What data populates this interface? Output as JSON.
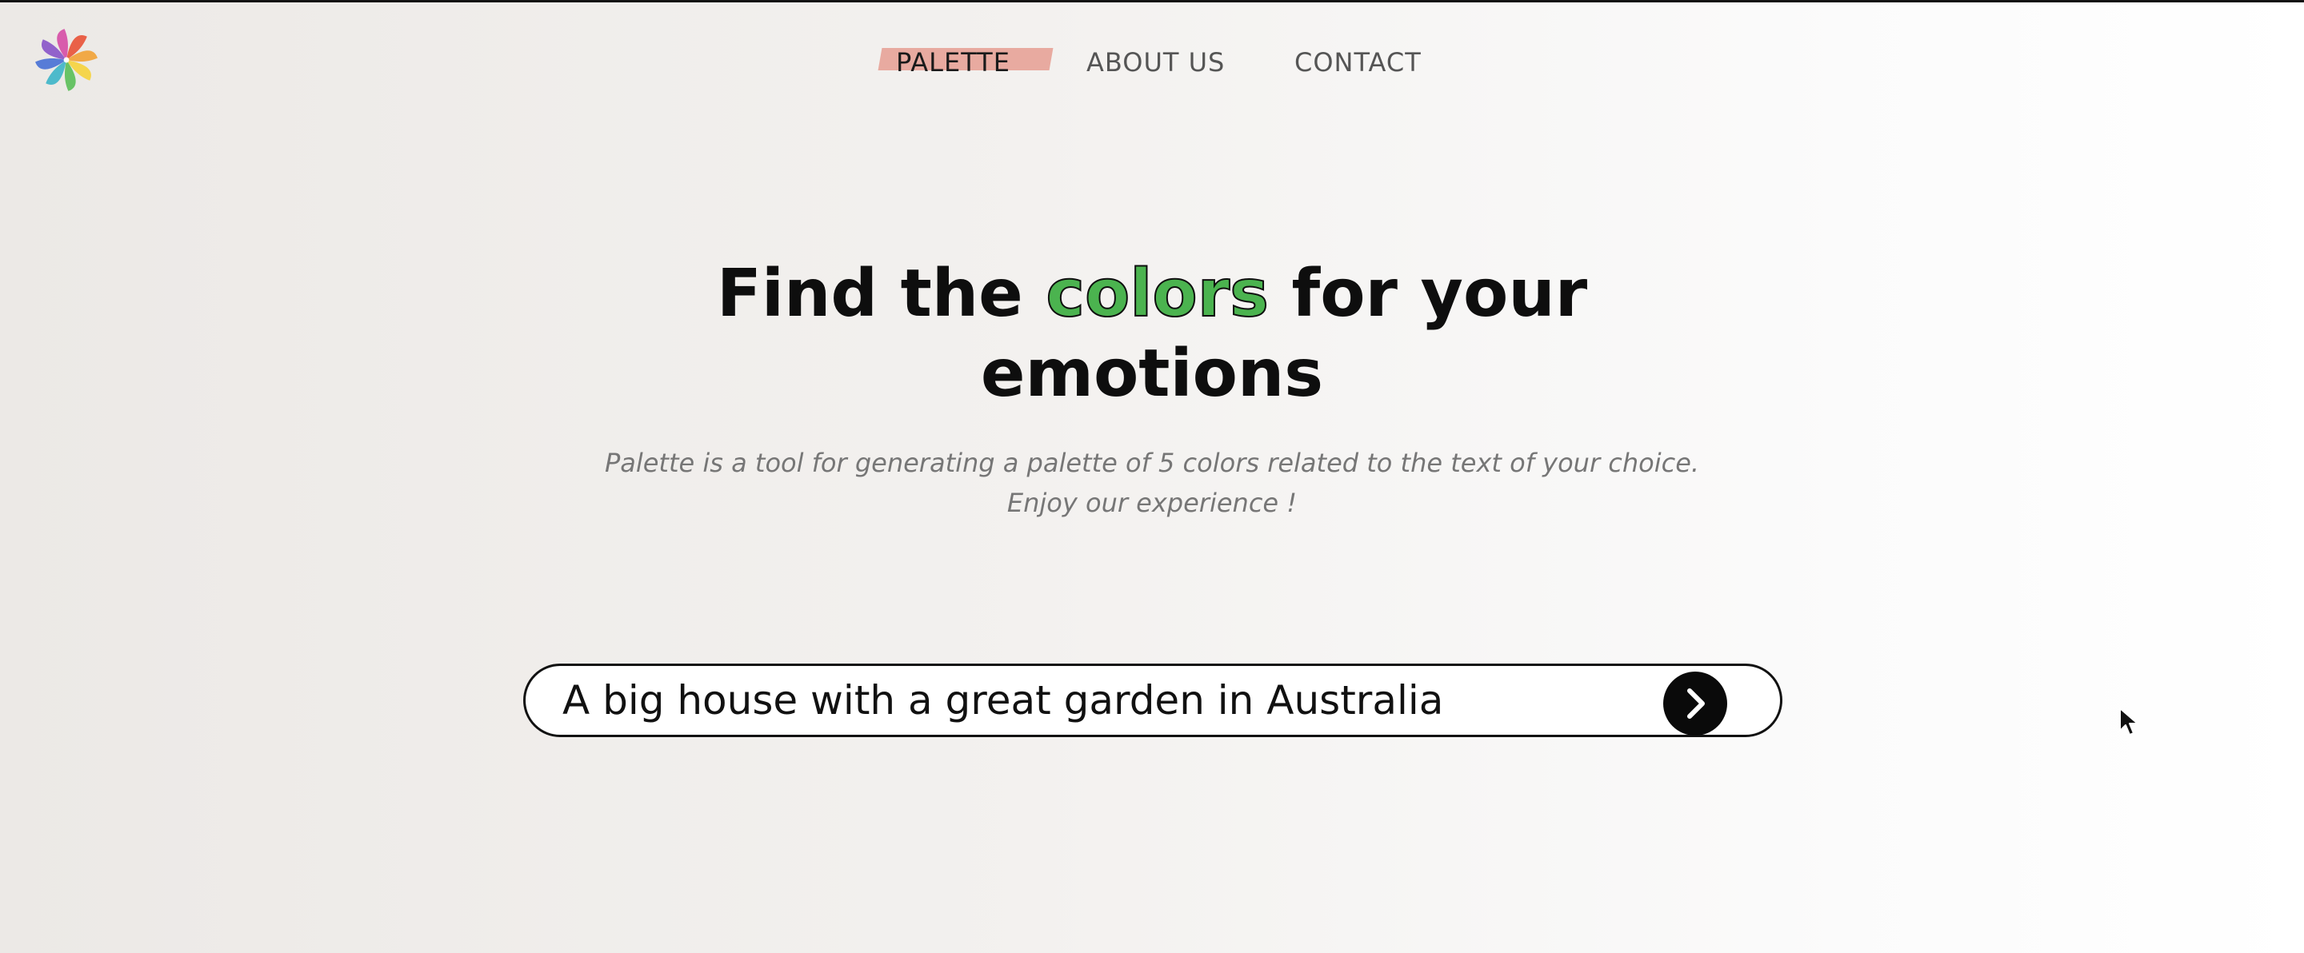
{
  "logo": {
    "icon": "pinwheel-logo-icon",
    "colors": [
      "#e8553b",
      "#f1a33a",
      "#f5d33f",
      "#5cbf5a",
      "#3fb5c9",
      "#4a72d6",
      "#8a56c9",
      "#d64fa7"
    ]
  },
  "nav": {
    "items": [
      {
        "label": "PALETTE",
        "active": true
      },
      {
        "label": "ABOUT US",
        "active": false
      },
      {
        "label": "CONTACT",
        "active": false
      }
    ],
    "highlight_color": "#e8aaa0"
  },
  "hero": {
    "title_before": "Find the ",
    "title_colored": "colors",
    "title_after": " for your",
    "title_line2": "emotions",
    "colored_word_color": "#4bb34f"
  },
  "subtitle": {
    "line1": "Palette is a tool for generating a palette of 5 colors related to the text of your choice.",
    "line2": "Enjoy our experience !"
  },
  "search": {
    "value": "A big house with a great garden in Australia",
    "submit_icon": "chevron-right-icon"
  }
}
